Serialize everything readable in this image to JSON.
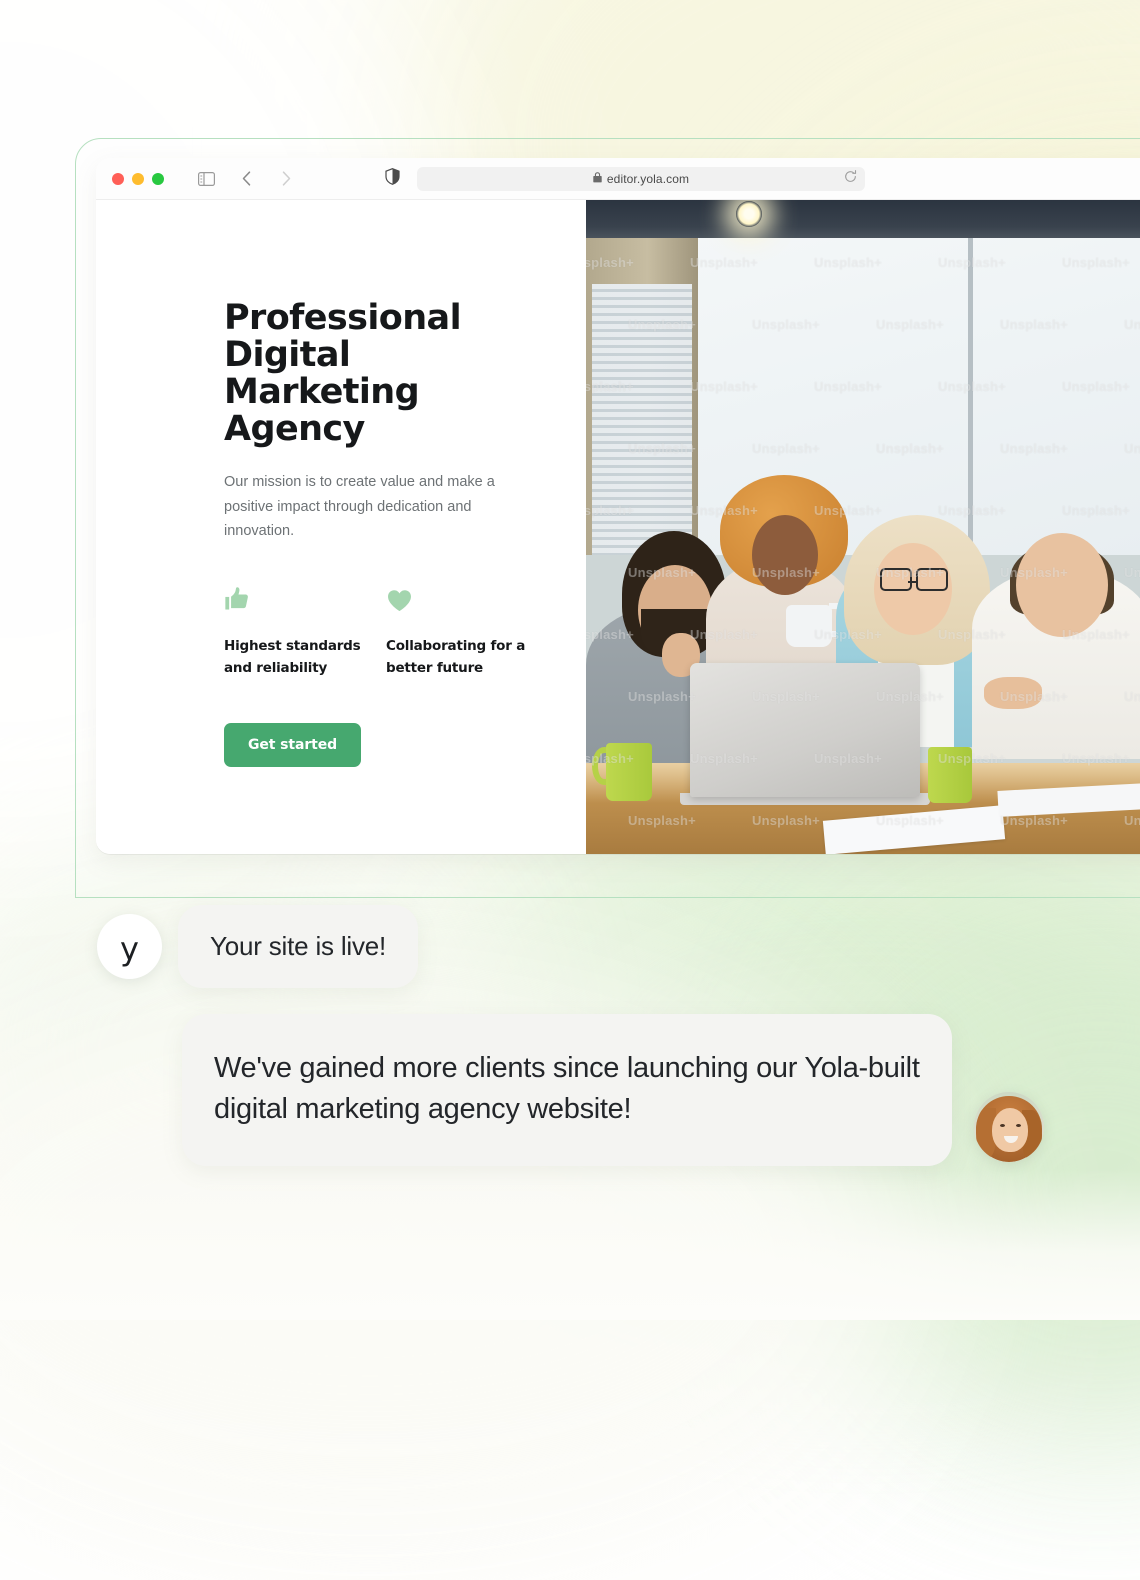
{
  "browser": {
    "traffic_lights": [
      {
        "name": "close",
        "color": "#ff5f57"
      },
      {
        "name": "minimize",
        "color": "#febc2e"
      },
      {
        "name": "maximize",
        "color": "#28c840"
      }
    ],
    "sidebar_icon": "sidebar-toggle-icon",
    "back_icon": "back-chevron-icon",
    "forward_icon": "forward-chevron-icon",
    "shield_icon": "privacy-shield-icon",
    "lock_icon": "lock-icon",
    "reload_icon": "reload-icon",
    "url": "editor.yola.com"
  },
  "site": {
    "hero_title": "Professional Digital Marketing Agency",
    "hero_subtitle": "Our mission is to create value and make a positive impact through dedication and innovation.",
    "features": [
      {
        "icon": "thumbs-up-icon",
        "label": "Highest standards and reliability"
      },
      {
        "icon": "heart-icon",
        "label": "Collaborating for a better future"
      }
    ],
    "cta_label": "Get started",
    "photo_watermark": "Unsplash+",
    "accent_green": "#46a86f",
    "feature_icon_green": "#a3d5ae"
  },
  "chat": {
    "brand_initial": "y",
    "messages": [
      {
        "sender": "yola",
        "text": "Your site is live!"
      },
      {
        "sender": "user",
        "text": "We've gained more clients since launching our Yola-built digital marketing agency website!"
      }
    ],
    "user_avatar": "user-avatar-photo"
  }
}
